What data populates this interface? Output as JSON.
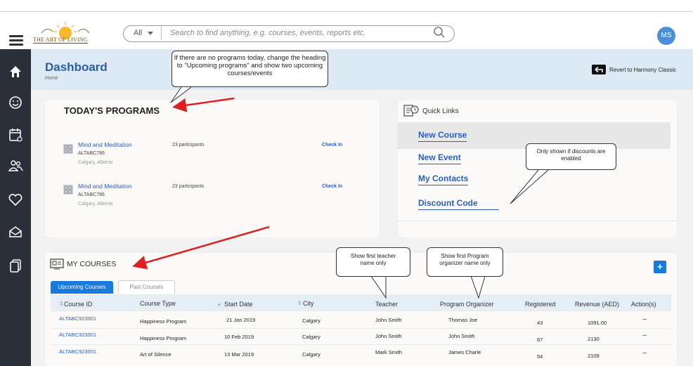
{
  "header": {
    "logo_text": "THE ART OF LIVING",
    "search_scope": "All",
    "search_placeholder": "Search to find anything, e.g. courses, events, reports etc.",
    "avatar_initials": "MS"
  },
  "sidebar": {
    "icons": [
      "home-icon",
      "smiley-icon",
      "calendar-icon",
      "people-icon",
      "heart-icon",
      "mail-icon",
      "copy-icon"
    ]
  },
  "dashboard": {
    "title": "Dashboard",
    "breadcrumb": "Home",
    "revert_label": "Revert to Harmony Classic"
  },
  "todays_programs": {
    "title": "TODAY'S PROGRAMS",
    "items": [
      {
        "name": "Mind and Meditation",
        "code": "ALTABC786",
        "location": "Calgary, Alberta",
        "participants": "23 participants",
        "action": "Check In"
      },
      {
        "name": "Mind and Meditation",
        "code": "ALTABC786",
        "location": "Calgary, Alberta",
        "participants": "23 participants",
        "action": "Check In"
      }
    ]
  },
  "quick_links": {
    "title": "Quick Links",
    "links": [
      "New Course",
      "New Event",
      "My Contacts",
      "Discount Code"
    ]
  },
  "my_courses": {
    "title": "MY COURSES",
    "add_label": "+",
    "tabs": [
      "Upcoming Courses",
      "Past Courses"
    ],
    "columns": [
      "Course  ID",
      "Course Type",
      "Start  Date",
      "City",
      "Teacher",
      "Program Organizer",
      "Registered",
      "Revenue (AED)",
      "Action(s)"
    ],
    "rows": [
      {
        "id": "ALTABC923001",
        "type": "Happiness Program",
        "date": "21 Jan 2019",
        "city": "Calgary",
        "teacher": "John Smith",
        "organizer": "Thomas Joe",
        "registered": "43",
        "revenue": "1091.00",
        "action": "..."
      },
      {
        "id": "ALTABC923001",
        "type": "Happiness Program",
        "date": "10 Feb 2019",
        "city": "Calgary",
        "teacher": "John Smith",
        "organizer": "John Smith",
        "registered": "67",
        "revenue": "2130",
        "action": "..."
      },
      {
        "id": "ALTABC923001",
        "type": "Art of Silence",
        "date": "13 Mar 2019",
        "city": "Calgary",
        "teacher": "Mark Smith",
        "organizer": "James Charle",
        "registered": "54",
        "revenue": "2109",
        "action": "..."
      }
    ]
  },
  "annotations": {
    "no_programs_note": "If there are no programs today, change the heading to \"Upcoming programs\" and show two upcoming  courses/events",
    "discount_note": "Only shown if discounts are enabled",
    "teacher_note": "Show first teacher name only",
    "organizer_note": "Show first Program organizer name only"
  },
  "colors": {
    "accent": "#1a7ad9",
    "link": "#2a5fb8",
    "sidebar": "#2b2f3a",
    "annotation_arrow": "#e02020"
  }
}
